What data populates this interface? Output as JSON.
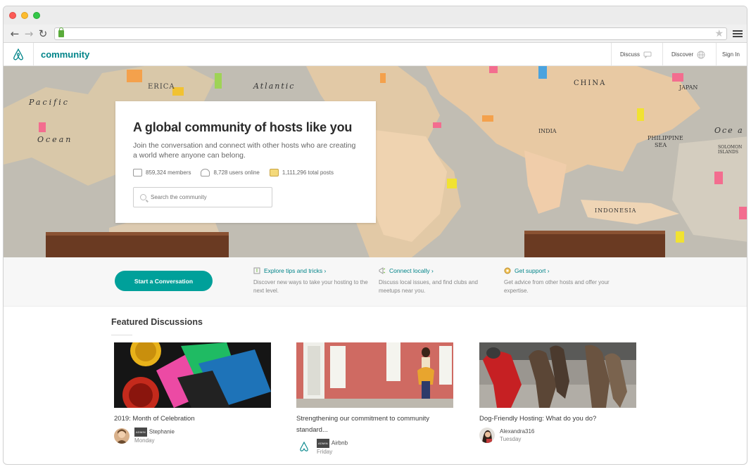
{
  "browser": {
    "url": ""
  },
  "header": {
    "brand": "community",
    "discuss": "Discuss",
    "discover": "Discover",
    "signin": "Sign In"
  },
  "hero": {
    "title": "A global community of hosts like you",
    "subtitle": "Join the conversation and connect with other hosts who are creating a world where anyone can belong.",
    "stats": {
      "members": "859,324 members",
      "online": "8,728 users online",
      "posts": "1,111,296 total posts"
    },
    "search_placeholder": "Search the community",
    "map_labels": [
      "ERICA",
      "Atlantic",
      "Pacific",
      "Ocean",
      "CHINA",
      "JAPAN",
      "Oce a",
      "INDIA",
      "PHILIPPINE",
      "SEA",
      "INDONESIA",
      "SOLOMON",
      "ISLANDS"
    ]
  },
  "actions": {
    "start_button": "Start a Conversation",
    "tips": [
      {
        "title": "Explore tips and tricks ›",
        "desc": "Discover new ways to take your hosting to the next level.",
        "icon": "lightbulb-icon"
      },
      {
        "title": "Connect locally ›",
        "desc": "Discuss local issues, and find clubs and meetups near you.",
        "icon": "megaphone-icon"
      },
      {
        "title": "Get support ›",
        "desc": "Get advice from other hosts and offer your expertise.",
        "icon": "support-icon"
      }
    ]
  },
  "featured": {
    "title": "Featured Discussions",
    "cards": [
      {
        "title": "2019: Month of Celebration",
        "badge": "ADMIN",
        "author": "Stephanie",
        "day": "Monday"
      },
      {
        "title": "Strengthening our commitment to community standard...",
        "badge": "ADMIN",
        "author": "Airbnb",
        "day": "Friday"
      },
      {
        "title": "Dog-Friendly Hosting: What do you do?",
        "badge": "",
        "author": "Alexandra316",
        "day": "Tuesday"
      }
    ]
  },
  "colors": {
    "accent": "#008489",
    "button": "#00a09a"
  }
}
